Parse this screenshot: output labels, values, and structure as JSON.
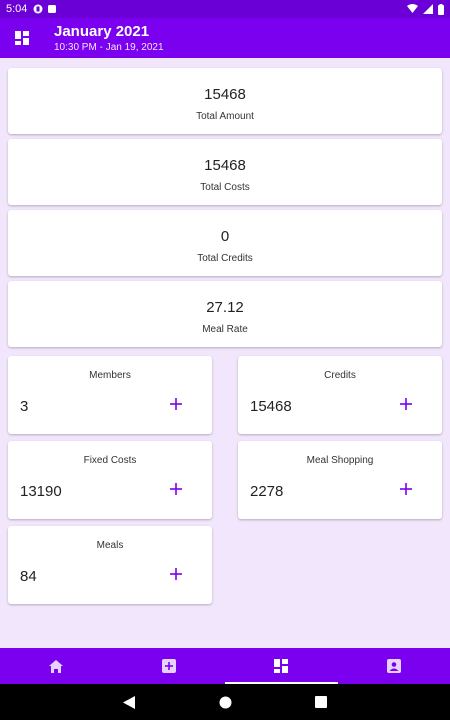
{
  "status_bar": {
    "time": "5:04"
  },
  "header": {
    "title": "January 2021",
    "subtitle": "10:30 PM - Jan 19, 2021"
  },
  "summary": [
    {
      "value": "15468",
      "label": "Total Amount"
    },
    {
      "value": "15468",
      "label": "Total Costs"
    },
    {
      "value": "0",
      "label": "Total Credits"
    },
    {
      "value": "27.12",
      "label": "Meal Rate"
    }
  ],
  "stats": {
    "members": {
      "label": "Members",
      "value": "3"
    },
    "credits": {
      "label": "Credits",
      "value": "15468"
    },
    "fixed_costs": {
      "label": "Fixed Costs",
      "value": "13190"
    },
    "meal_shopping": {
      "label": "Meal Shopping",
      "value": "2278"
    },
    "meals": {
      "label": "Meals",
      "value": "84"
    }
  },
  "bottom_nav": {
    "items": [
      {
        "icon": "home-icon"
      },
      {
        "icon": "add-box-icon"
      },
      {
        "icon": "dashboard-icon",
        "active": true
      },
      {
        "icon": "account-box-icon"
      }
    ]
  },
  "colors": {
    "primary": "#7c00f0",
    "status": "#6a00d6",
    "background": "#f1e6fb",
    "accent": "#7c00f0"
  }
}
